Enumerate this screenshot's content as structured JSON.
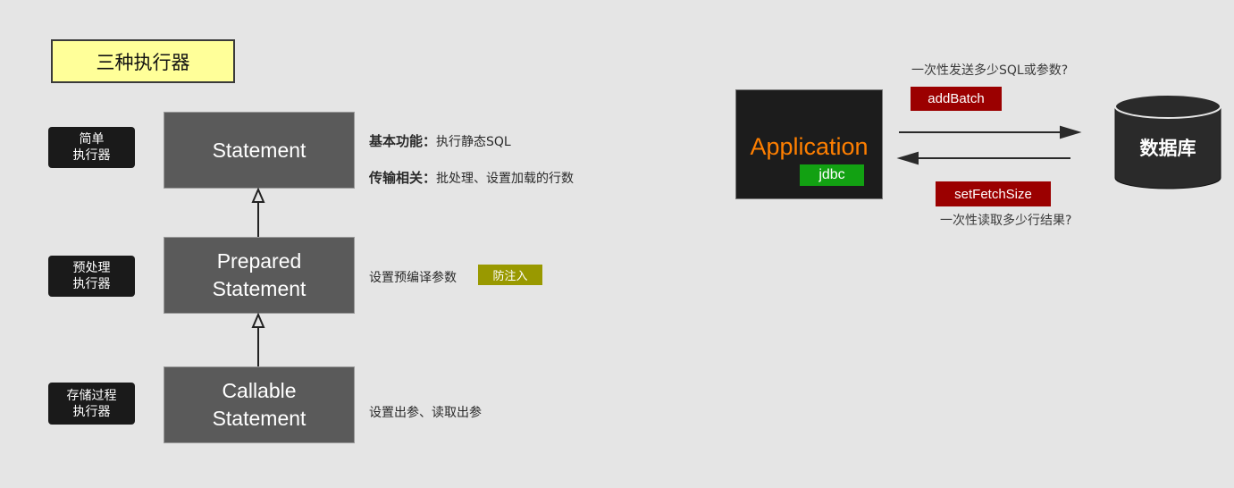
{
  "title": "三种执行器",
  "executors": [
    {
      "tag_lines": [
        "简单",
        "执行器"
      ],
      "box_lines": [
        "Statement"
      ]
    },
    {
      "tag_lines": [
        "预处理",
        "执行器"
      ],
      "box_lines": [
        "Prepared",
        "Statement"
      ]
    },
    {
      "tag_lines": [
        "存储过程",
        "执行器"
      ],
      "box_lines": [
        "Callable",
        "Statement"
      ]
    }
  ],
  "statement_desc": {
    "basic_label": "基本功能：",
    "basic_text": "执行静态SQL",
    "transfer_label": "传输相关：",
    "transfer_text": "批处理、设置加载的行数"
  },
  "prepared_desc": {
    "text": "设置预编译参数",
    "badge": "防注入"
  },
  "callable_desc": {
    "text": "设置出参、读取出参"
  },
  "application": {
    "title": "Application",
    "badge": "jdbc"
  },
  "database": {
    "label": "数据库"
  },
  "flow": {
    "send_question": "一次性发送多少SQL或参数?",
    "send_method": "addBatch",
    "read_method": "setFetchSize",
    "read_question": "一次性读取多少行结果?"
  },
  "colors": {
    "title_fill": "#ffff99",
    "statement_box": "#5a5a5a",
    "tag_fill": "#1a1a1a",
    "olive_badge": "#999900",
    "app_title": "#ff7f00",
    "jdbc_badge": "#12a112",
    "method_badge": "#9b0000",
    "database_fill": "#2a2a2a"
  }
}
